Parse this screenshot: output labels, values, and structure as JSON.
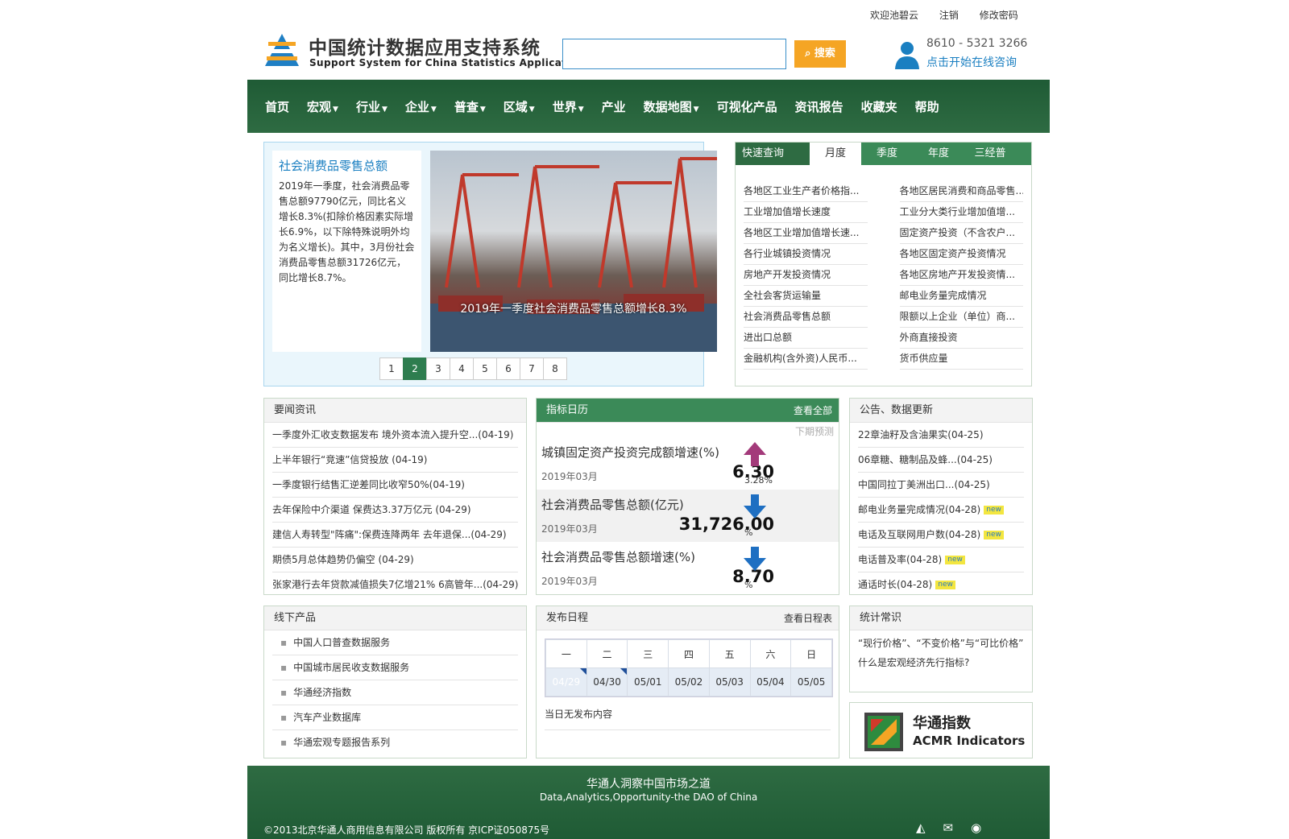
{
  "topbar": {
    "welcome": "欢迎池碧云",
    "logout": "注销",
    "change_pwd": "修改密码"
  },
  "logo": {
    "cn": "中国统计数据应用支持系统",
    "en": "Support System for China Statistics Application"
  },
  "search": {
    "placeholder": "",
    "button": "搜索"
  },
  "contact": {
    "phone": "8610 - 5321 3266",
    "consult": "点击开始在线咨询"
  },
  "nav": [
    {
      "label": "首页",
      "drop": false
    },
    {
      "label": "宏观",
      "drop": true
    },
    {
      "label": "行业",
      "drop": true
    },
    {
      "label": "企业",
      "drop": true
    },
    {
      "label": "普查",
      "drop": true
    },
    {
      "label": "区域",
      "drop": true
    },
    {
      "label": "世界",
      "drop": true
    },
    {
      "label": "产业",
      "drop": false
    },
    {
      "label": "数据地图",
      "drop": true
    },
    {
      "label": "可视化产品",
      "drop": false
    },
    {
      "label": "资讯报告",
      "drop": false
    },
    {
      "label": "收藏夹",
      "drop": false
    },
    {
      "label": "帮助",
      "drop": false
    }
  ],
  "slider": {
    "title": "社会消费品零售总额",
    "text": "2019年一季度，社会消费品零售总额97790亿元，同比名义增长8.3%(扣除价格因素实际增长6.9%，以下除特殊说明外均为名义增长)。其中，3月份社会消费品零售总额31726亿元，同比增长8.7%。",
    "caption": "2019年一季度社会消费品零售总额增长8.3%",
    "pages": [
      "1",
      "2",
      "3",
      "4",
      "5",
      "6",
      "7",
      "8"
    ],
    "active_page": "2"
  },
  "quick": {
    "title": "快速查询",
    "tabs": [
      "月度",
      "季度",
      "年度",
      "三经普"
    ],
    "active_tab": "月度",
    "items": [
      "各地区工业生产者价格指...",
      "各地区居民消费和商品零售...",
      "工业增加值增长速度",
      "工业分大类行业增加值增...",
      "各地区工业增加值增长速...",
      "固定资产投资（不含农户...",
      "各行业城镇投资情况",
      "各地区固定资产投资情况",
      "房地产开发投资情况",
      "各地区房地产开发投资情...",
      "全社会客货运输量",
      "邮电业务量完成情况",
      "社会消费品零售总额",
      "限额以上企业（单位）商...",
      "进出口总额",
      "外商直接投资",
      "金融机构(含外资)人民币...",
      "货币供应量"
    ]
  },
  "news": {
    "title": "要闻资讯",
    "items": [
      "一季度外汇收支数据发布 境外资本流入提升空...(04-19)",
      "上半年银行“竞速”信贷投放 (04-19)",
      "一季度银行结售汇逆差同比收窄50%(04-19)",
      "去年保险中介渠道 保费达3.37万亿元 (04-29)",
      "建信人寿转型\"阵痛\":保费连降两年 去年退保...(04-29)",
      "期债5月总体趋势仍偏空 (04-29)",
      "张家港行去年贷款减值损失7亿增21% 6高管年...(04-29)"
    ]
  },
  "indicators": {
    "title": "指标日历",
    "more": "查看全部",
    "forecast": "下期预测",
    "items": [
      {
        "name": "城镇固定资产投资完成额增速(%)",
        "date": "2019年03月",
        "value": "6.30",
        "unit": "3.28%",
        "dir": "up"
      },
      {
        "name": "社会消费品零售总额(亿元)",
        "date": "2019年03月",
        "value": "31,726.00",
        "unit": "%",
        "dir": "down"
      },
      {
        "name": "社会消费品零售总额增速(%)",
        "date": "2019年03月",
        "value": "8.70",
        "unit": "%",
        "dir": "down"
      }
    ]
  },
  "notice": {
    "title": "公告、数据更新",
    "items": [
      {
        "text": "22章油籽及含油果实(04-25)",
        "new": false
      },
      {
        "text": "06章糖、糖制品及蜂...(04-25)",
        "new": false
      },
      {
        "text": "中国同拉丁美洲出口...(04-25)",
        "new": false
      },
      {
        "text": "邮电业务量完成情况(04-28)",
        "new": true
      },
      {
        "text": "电话及互联网用户数(04-28)",
        "new": true
      },
      {
        "text": "电话普及率(04-28)",
        "new": true
      },
      {
        "text": "通话时长(04-28)",
        "new": true
      }
    ],
    "new_label": "new"
  },
  "offline": {
    "title": "线下产品",
    "items": [
      "中国人口普查数据服务",
      "中国城市居民收支数据服务",
      "华通经济指数",
      "汽车产业数据库",
      "华通宏观专题报告系列"
    ]
  },
  "schedule": {
    "title": "发布日程",
    "more": "查看日程表",
    "weekdays": [
      "一",
      "二",
      "三",
      "四",
      "五",
      "六",
      "日"
    ],
    "dates": [
      "04/29",
      "04/30",
      "05/01",
      "05/02",
      "05/03",
      "05/04",
      "05/05"
    ],
    "selected": "04/29",
    "note": "当日无发布内容"
  },
  "knowledge": {
    "title": "统计常识",
    "items": [
      "“现行价格”、“不变价格”与“可比价格”",
      "什么是宏观经济先行指标?"
    ]
  },
  "huatong": {
    "cn": "华通指数",
    "en": "ACMR Indicators"
  },
  "footer": {
    "slogan": "华通人洞察中国市场之道",
    "slogan_en": "Data,Analytics,Opportunity-the DAO of China",
    "copyright": "©2013北京华通人商用信息有限公司 版权所有 京ICP证050875号"
  },
  "colors": {
    "nav": "#2e6b42",
    "accent": "#1a7fc1",
    "search_btn": "#f5a524",
    "selected_date": "#2b6fc2"
  }
}
